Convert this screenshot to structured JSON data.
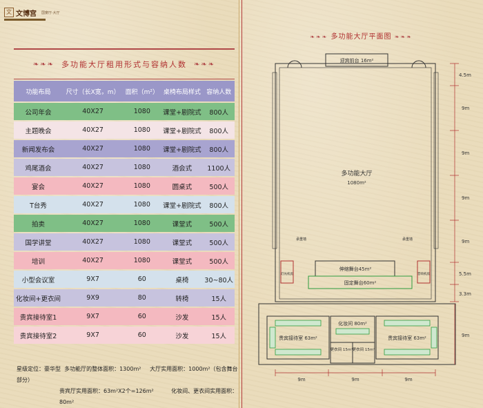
{
  "logo": {
    "name": "文博宫",
    "sub": "国宴厅·大厅"
  },
  "left_title": "多功能大厅租用形式与容纳人数",
  "table": {
    "headers": [
      "功能布局",
      "尺寸（长X宽，m）",
      "面积（m²）",
      "桌椅布局样式",
      "容纳人数"
    ],
    "rows": [
      [
        "公司年会",
        "40X27",
        "1080",
        "课堂+剧院式",
        "800人"
      ],
      [
        "主题晚会",
        "40X27",
        "1080",
        "课堂+剧院式",
        "800人"
      ],
      [
        "新闻发布会",
        "40X27",
        "1080",
        "课堂+剧院式",
        "800人"
      ],
      [
        "鸡尾酒会",
        "40X27",
        "1080",
        "酒会式",
        "1100人"
      ],
      [
        "宴会",
        "40X27",
        "1080",
        "圆桌式",
        "500人"
      ],
      [
        "T台秀",
        "40X27",
        "1080",
        "课堂+剧院式",
        "800人"
      ],
      [
        "拍卖",
        "40X27",
        "1080",
        "课堂式",
        "500人"
      ],
      [
        "国学讲堂",
        "40X27",
        "1080",
        "课堂式",
        "500人"
      ],
      [
        "培训",
        "40X27",
        "1080",
        "课堂式",
        "500人"
      ],
      [
        "小型会议室",
        "9X7",
        "60",
        "桌椅",
        "30~80人"
      ],
      [
        "化妆间+更衣间",
        "9X9",
        "80",
        "转椅",
        "15人"
      ],
      [
        "贵宾接待室1",
        "9X7",
        "60",
        "沙发",
        "15人"
      ],
      [
        "贵宾接待室2",
        "9X7",
        "60",
        "沙发",
        "15人"
      ]
    ],
    "row_colors": [
      "#7fbf86",
      "#f4e4e6",
      "#a8a4d0",
      "#c7c3de",
      "#f4b9c0",
      "#d4e1ec",
      "#7fbf86",
      "#c7c3de",
      "#f4b9c0",
      "#d4e1ec",
      "#c7c3de",
      "#f4b9c0",
      "#f7d3d7"
    ],
    "header_color": "#9a97c8"
  },
  "footer": {
    "line1_a": "星级定位：豪华型",
    "line1_b": "多功能厅的整体面积：1300m²",
    "line1_c": "大厅实用面积：1000m²（包含舞台部分）",
    "line2_a": "贵宾厅实用面积：63m²X2个=126m²",
    "line2_b": "化妆间、更衣间实用面积：80m²"
  },
  "plan": {
    "title": "多功能大厅平面图",
    "lobby": "迎宾前台 16m²",
    "hall": "多功能大厅",
    "hall_area": "1080m²",
    "stage_ext": "伸缩舞台45m²",
    "stage_fixed": "固定舞台60m²",
    "vip_left": "贵宾接待室 63m²",
    "vip_right": "贵宾接待室 63m²",
    "makeup": "化妆间 80m²",
    "dress1": "更衣间 15m²",
    "dress2": "更衣间 15m²",
    "ctrl_left": "灯光机房",
    "ctrl_right": "音响机房",
    "pillar_left": "承重墙",
    "pillar_right": "承重墙",
    "dims_right": [
      "4.5m",
      "9m",
      "9m",
      "9m",
      "9m",
      "5.5m",
      "3.3m",
      "9m"
    ],
    "dims_bottom": [
      "9m",
      "9m",
      "9m"
    ]
  },
  "colors": {
    "accent": "#b03030",
    "plan_line": "#333333",
    "furniture": "#2e9c3e"
  }
}
